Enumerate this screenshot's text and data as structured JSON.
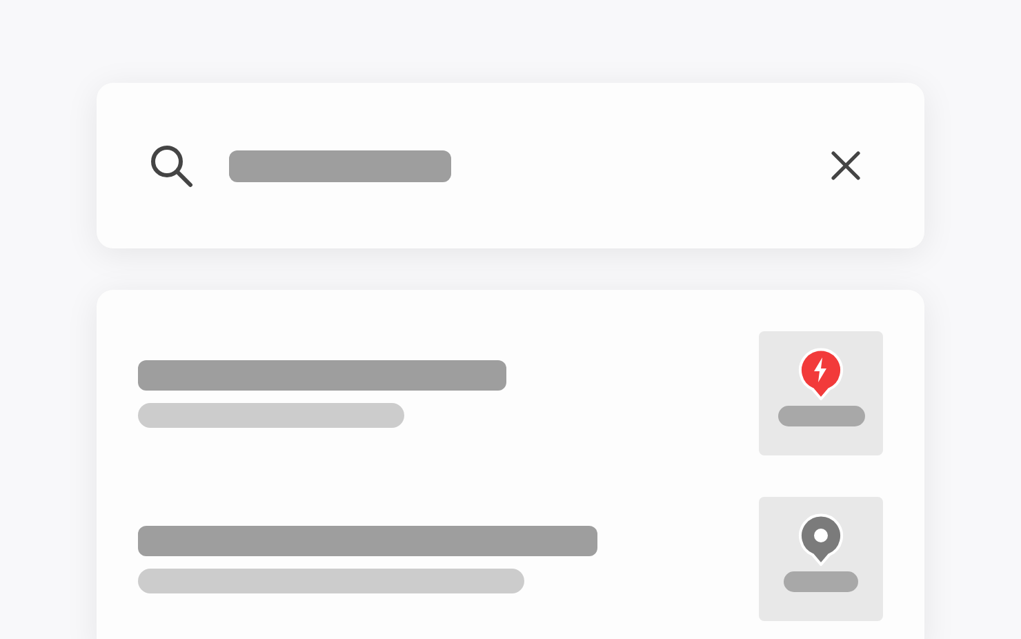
{
  "results": [
    {
      "kind": "charger",
      "color": "#f23a3a"
    },
    {
      "kind": "location",
      "color": "#7b7b7b"
    }
  ]
}
